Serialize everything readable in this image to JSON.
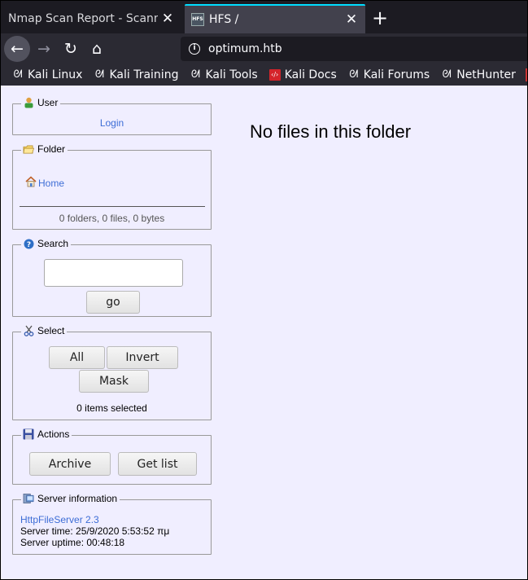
{
  "tabs": [
    {
      "title": "Nmap Scan Report - Scanned at",
      "favicon": "none"
    },
    {
      "title": "HFS /",
      "favicon": "hfs-icon",
      "favicon_text": "HFS"
    }
  ],
  "new_tab": "+",
  "tab_close": "✕",
  "nav": {
    "back": "←",
    "forward": "→",
    "reload": "↻",
    "home": "⌂",
    "url": "optimum.htb"
  },
  "bookmarks": [
    {
      "label": "Kali Linux",
      "icon": "kali-dragon-icon"
    },
    {
      "label": "Kali Training",
      "icon": "kali-dragon-icon"
    },
    {
      "label": "Kali Tools",
      "icon": "kali-dragon-icon"
    },
    {
      "label": "Kali Docs",
      "icon": "kali-docs-icon"
    },
    {
      "label": "Kali Forums",
      "icon": "kali-dragon-icon"
    },
    {
      "label": "NetHunter",
      "icon": "nethunter-icon"
    }
  ],
  "sidebar": {
    "user": {
      "legend": "User",
      "login": "Login"
    },
    "folder": {
      "legend": "Folder",
      "home": "Home",
      "stats": "0 folders, 0 files, 0 bytes"
    },
    "search": {
      "legend": "Search",
      "go": "go",
      "value": ""
    },
    "select": {
      "legend": "Select",
      "all": "All",
      "invert": "Invert",
      "mask": "Mask",
      "status": "0 items selected"
    },
    "actions": {
      "legend": "Actions",
      "archive": "Archive",
      "get_list": "Get list"
    },
    "server": {
      "legend": "Server information",
      "version_link": "HttpFileServer 2.3",
      "time": "Server time: 25/9/2020 5:53:52 πμ",
      "uptime": "Server uptime: 00:48:18"
    }
  },
  "main": {
    "message": "No files in this folder"
  },
  "colors": {
    "accent": "#00ddff",
    "page_bg": "#f0eeff",
    "link": "#3d6dd6",
    "toolbar": "#2b2a33"
  }
}
